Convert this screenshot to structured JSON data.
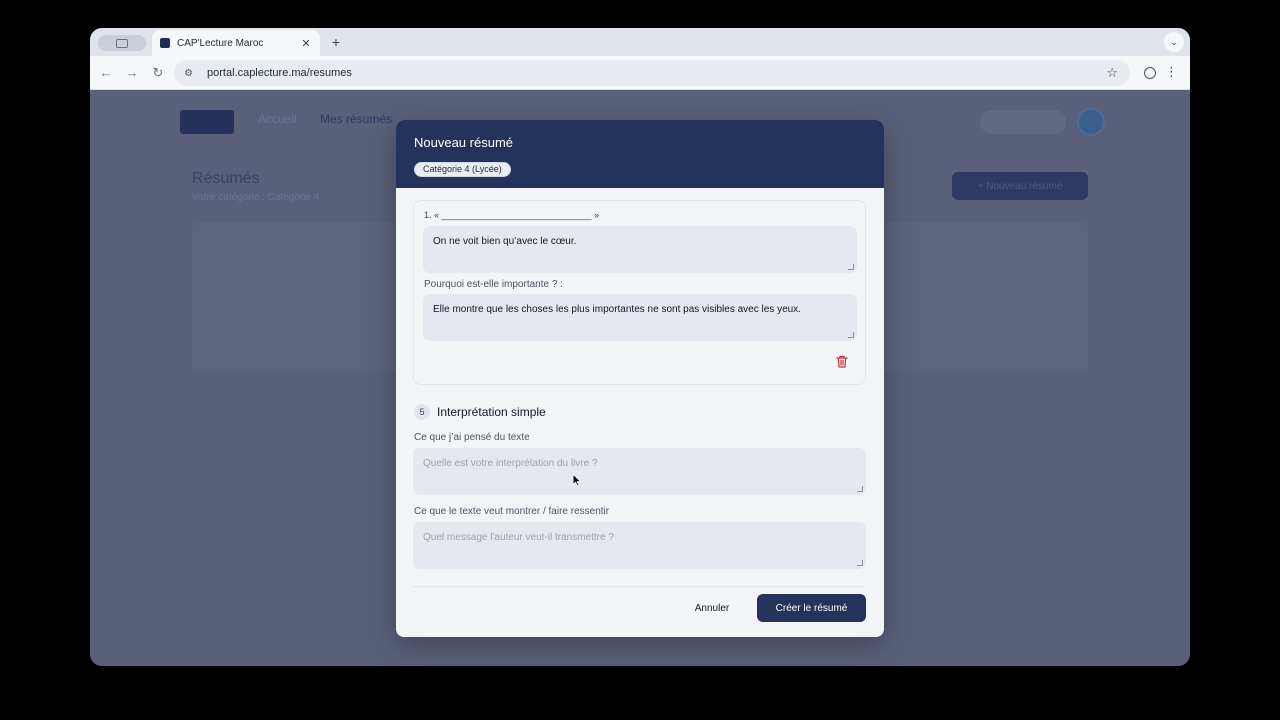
{
  "browser": {
    "tab_title": "CAP'Lecture Maroc",
    "tab_close": "✕",
    "new_tab": "+",
    "tab_menu": "⌄",
    "url": "portal.caplecture.ma/resumes",
    "back": "←",
    "forward": "→",
    "reload": "↻",
    "site_info": "⚙",
    "star": "☆",
    "menu": "⋮"
  },
  "background_page": {
    "nav": [
      "Accueil",
      "Mes résumés"
    ],
    "title": "Résumés",
    "subtitle": "Votre catégorie : Catégorie 4",
    "new_button": "+  Nouveau résumé"
  },
  "modal": {
    "title": "Nouveau résumé",
    "category_badge": "Catégorie 4 (Lycée)",
    "quote_item": {
      "label": "1. « ______________________________ »",
      "quote": "On ne voit bien qu’avec le cœur.",
      "why_label": "Pourquoi est-elle importante ? :",
      "why_value": "Elle montre que les choses les plus importantes ne sont pas visibles avec les yeux."
    },
    "section": {
      "number": "5",
      "title": "Interprétation simple",
      "field1_label": "Ce que j’ai pensé du texte",
      "field1_placeholder": "Quelle est votre interprétation du livre ?",
      "field2_label": "Ce que le texte veut montrer / faire ressentir",
      "field2_placeholder": "Quel message l'auteur veut-il transmettre ?"
    },
    "cancel_label": "Annuler",
    "create_label": "Créer le résumé"
  },
  "colors": {
    "header": "#24335c",
    "primary_button": "#24335c",
    "overlay": "#596079",
    "delete": "#c0313a"
  }
}
